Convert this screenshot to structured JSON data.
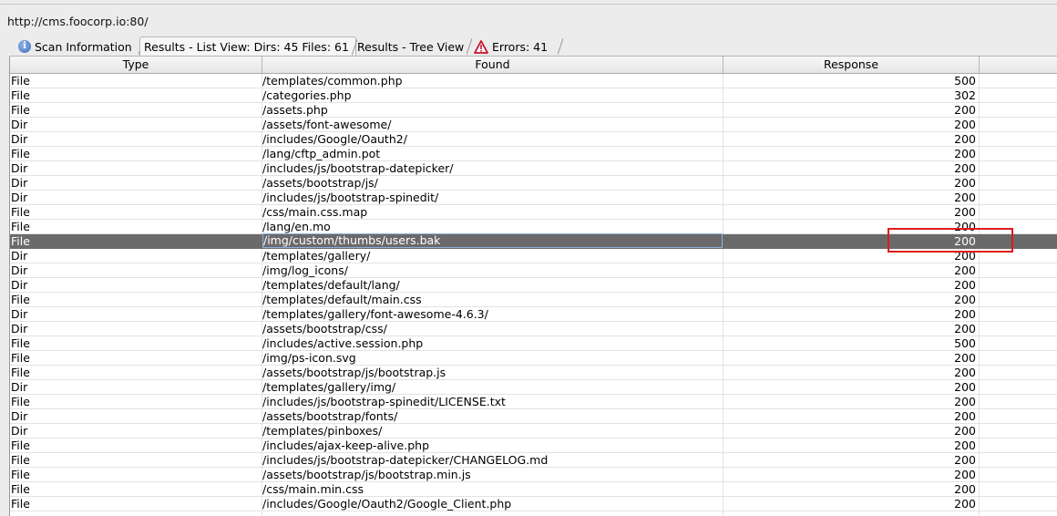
{
  "url": "http://cms.foocorp.io:80/",
  "tabs": [
    {
      "label": "Scan Information",
      "icon": "info-icon"
    },
    {
      "label": "Results - List View: Dirs: 45 Files: 61",
      "active": true
    },
    {
      "label": "Results - Tree View"
    },
    {
      "label": "Errors: 41",
      "icon": "warning-icon"
    }
  ],
  "table": {
    "columns": [
      "Type",
      "Found",
      "Response"
    ],
    "selected_index": 11,
    "rows": [
      [
        "File",
        "/templates/common.php",
        "500"
      ],
      [
        "File",
        "/categories.php",
        "302"
      ],
      [
        "File",
        "/assets.php",
        "200"
      ],
      [
        "Dir",
        "/assets/font-awesome/",
        "200"
      ],
      [
        "Dir",
        "/includes/Google/Oauth2/",
        "200"
      ],
      [
        "File",
        "/lang/cftp_admin.pot",
        "200"
      ],
      [
        "Dir",
        "/includes/js/bootstrap-datepicker/",
        "200"
      ],
      [
        "Dir",
        "/assets/bootstrap/js/",
        "200"
      ],
      [
        "Dir",
        "/includes/js/bootstrap-spinedit/",
        "200"
      ],
      [
        "File",
        "/css/main.css.map",
        "200"
      ],
      [
        "File",
        "/lang/en.mo",
        "200"
      ],
      [
        "File",
        "/img/custom/thumbs/users.bak",
        "200"
      ],
      [
        "Dir",
        "/templates/gallery/",
        "200"
      ],
      [
        "Dir",
        "/img/log_icons/",
        "200"
      ],
      [
        "Dir",
        "/templates/default/lang/",
        "200"
      ],
      [
        "File",
        "/templates/default/main.css",
        "200"
      ],
      [
        "Dir",
        "/templates/gallery/font-awesome-4.6.3/",
        "200"
      ],
      [
        "Dir",
        "/assets/bootstrap/css/",
        "200"
      ],
      [
        "File",
        "/includes/active.session.php",
        "500"
      ],
      [
        "File",
        "/img/ps-icon.svg",
        "200"
      ],
      [
        "File",
        "/assets/bootstrap/js/bootstrap.js",
        "200"
      ],
      [
        "Dir",
        "/templates/gallery/img/",
        "200"
      ],
      [
        "File",
        "/includes/js/bootstrap-spinedit/LICENSE.txt",
        "200"
      ],
      [
        "Dir",
        "/assets/bootstrap/fonts/",
        "200"
      ],
      [
        "Dir",
        "/templates/pinboxes/",
        "200"
      ],
      [
        "File",
        "/includes/ajax-keep-alive.php",
        "200"
      ],
      [
        "File",
        "/includes/js/bootstrap-datepicker/CHANGELOG.md",
        "200"
      ],
      [
        "File",
        "/assets/bootstrap/js/bootstrap.min.js",
        "200"
      ],
      [
        "File",
        "/css/main.min.css",
        "200"
      ],
      [
        "File",
        "/includes/Google/Oauth2/Google_Client.php",
        "200"
      ]
    ]
  },
  "colors": {
    "selected_row": "#6a6a6a",
    "highlight_box": "#e01c1c"
  }
}
